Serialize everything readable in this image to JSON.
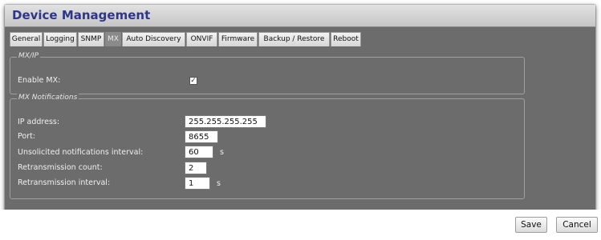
{
  "window": {
    "title": "Device Management"
  },
  "tabs": [
    {
      "label": "General"
    },
    {
      "label": "Logging"
    },
    {
      "label": "SNMP"
    },
    {
      "label": "MX",
      "active": true
    },
    {
      "label": "Auto Discovery"
    },
    {
      "label": "ONVIF"
    },
    {
      "label": "Firmware"
    },
    {
      "label": "Backup / Restore"
    },
    {
      "label": "Reboot"
    }
  ],
  "mxip": {
    "legend": "MX/IP",
    "enable_label": "Enable MX:",
    "enable_checked": true
  },
  "notifications": {
    "legend": "MX Notifications",
    "ip_label": "IP address:",
    "ip_value": "255.255.255.255",
    "port_label": "Port:",
    "port_value": "8655",
    "unsolicited_label": "Unsolicited notifications interval:",
    "unsolicited_value": "60",
    "unsolicited_unit": "s",
    "retrans_count_label": "Retransmission count:",
    "retrans_count_value": "2",
    "retrans_interval_label": "Retransmission interval:",
    "retrans_interval_value": "1",
    "retrans_interval_unit": "s"
  },
  "footer": {
    "save_label": "Save",
    "cancel_label": "Cancel"
  },
  "colors": {
    "title": "#2f3688",
    "panel": "#6c6c6c"
  }
}
